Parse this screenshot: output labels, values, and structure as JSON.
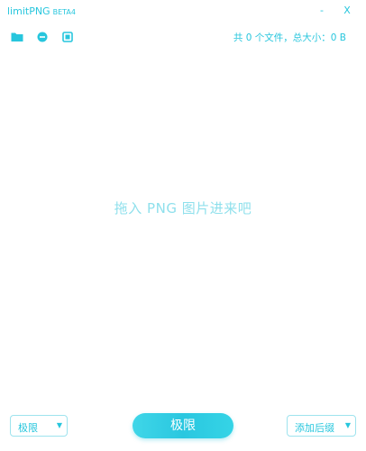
{
  "titlebar": {
    "app_name": "limitPNG",
    "version": "BETA4",
    "minimize_label": "-",
    "close_label": "X"
  },
  "toolbar": {
    "icons": [
      "folder-icon",
      "remove-icon",
      "stop-icon"
    ],
    "summary": "共 0 个文件，总大小：0 B"
  },
  "dropzone": {
    "hint": "拖入 PNG 图片进来吧"
  },
  "bottom": {
    "level_select": "极限",
    "compress_button": "极限",
    "suffix_select": "添加后缀"
  },
  "colors": {
    "accent": "#27c6dd",
    "hint": "#8fe0ec",
    "background": "#ffffff"
  }
}
